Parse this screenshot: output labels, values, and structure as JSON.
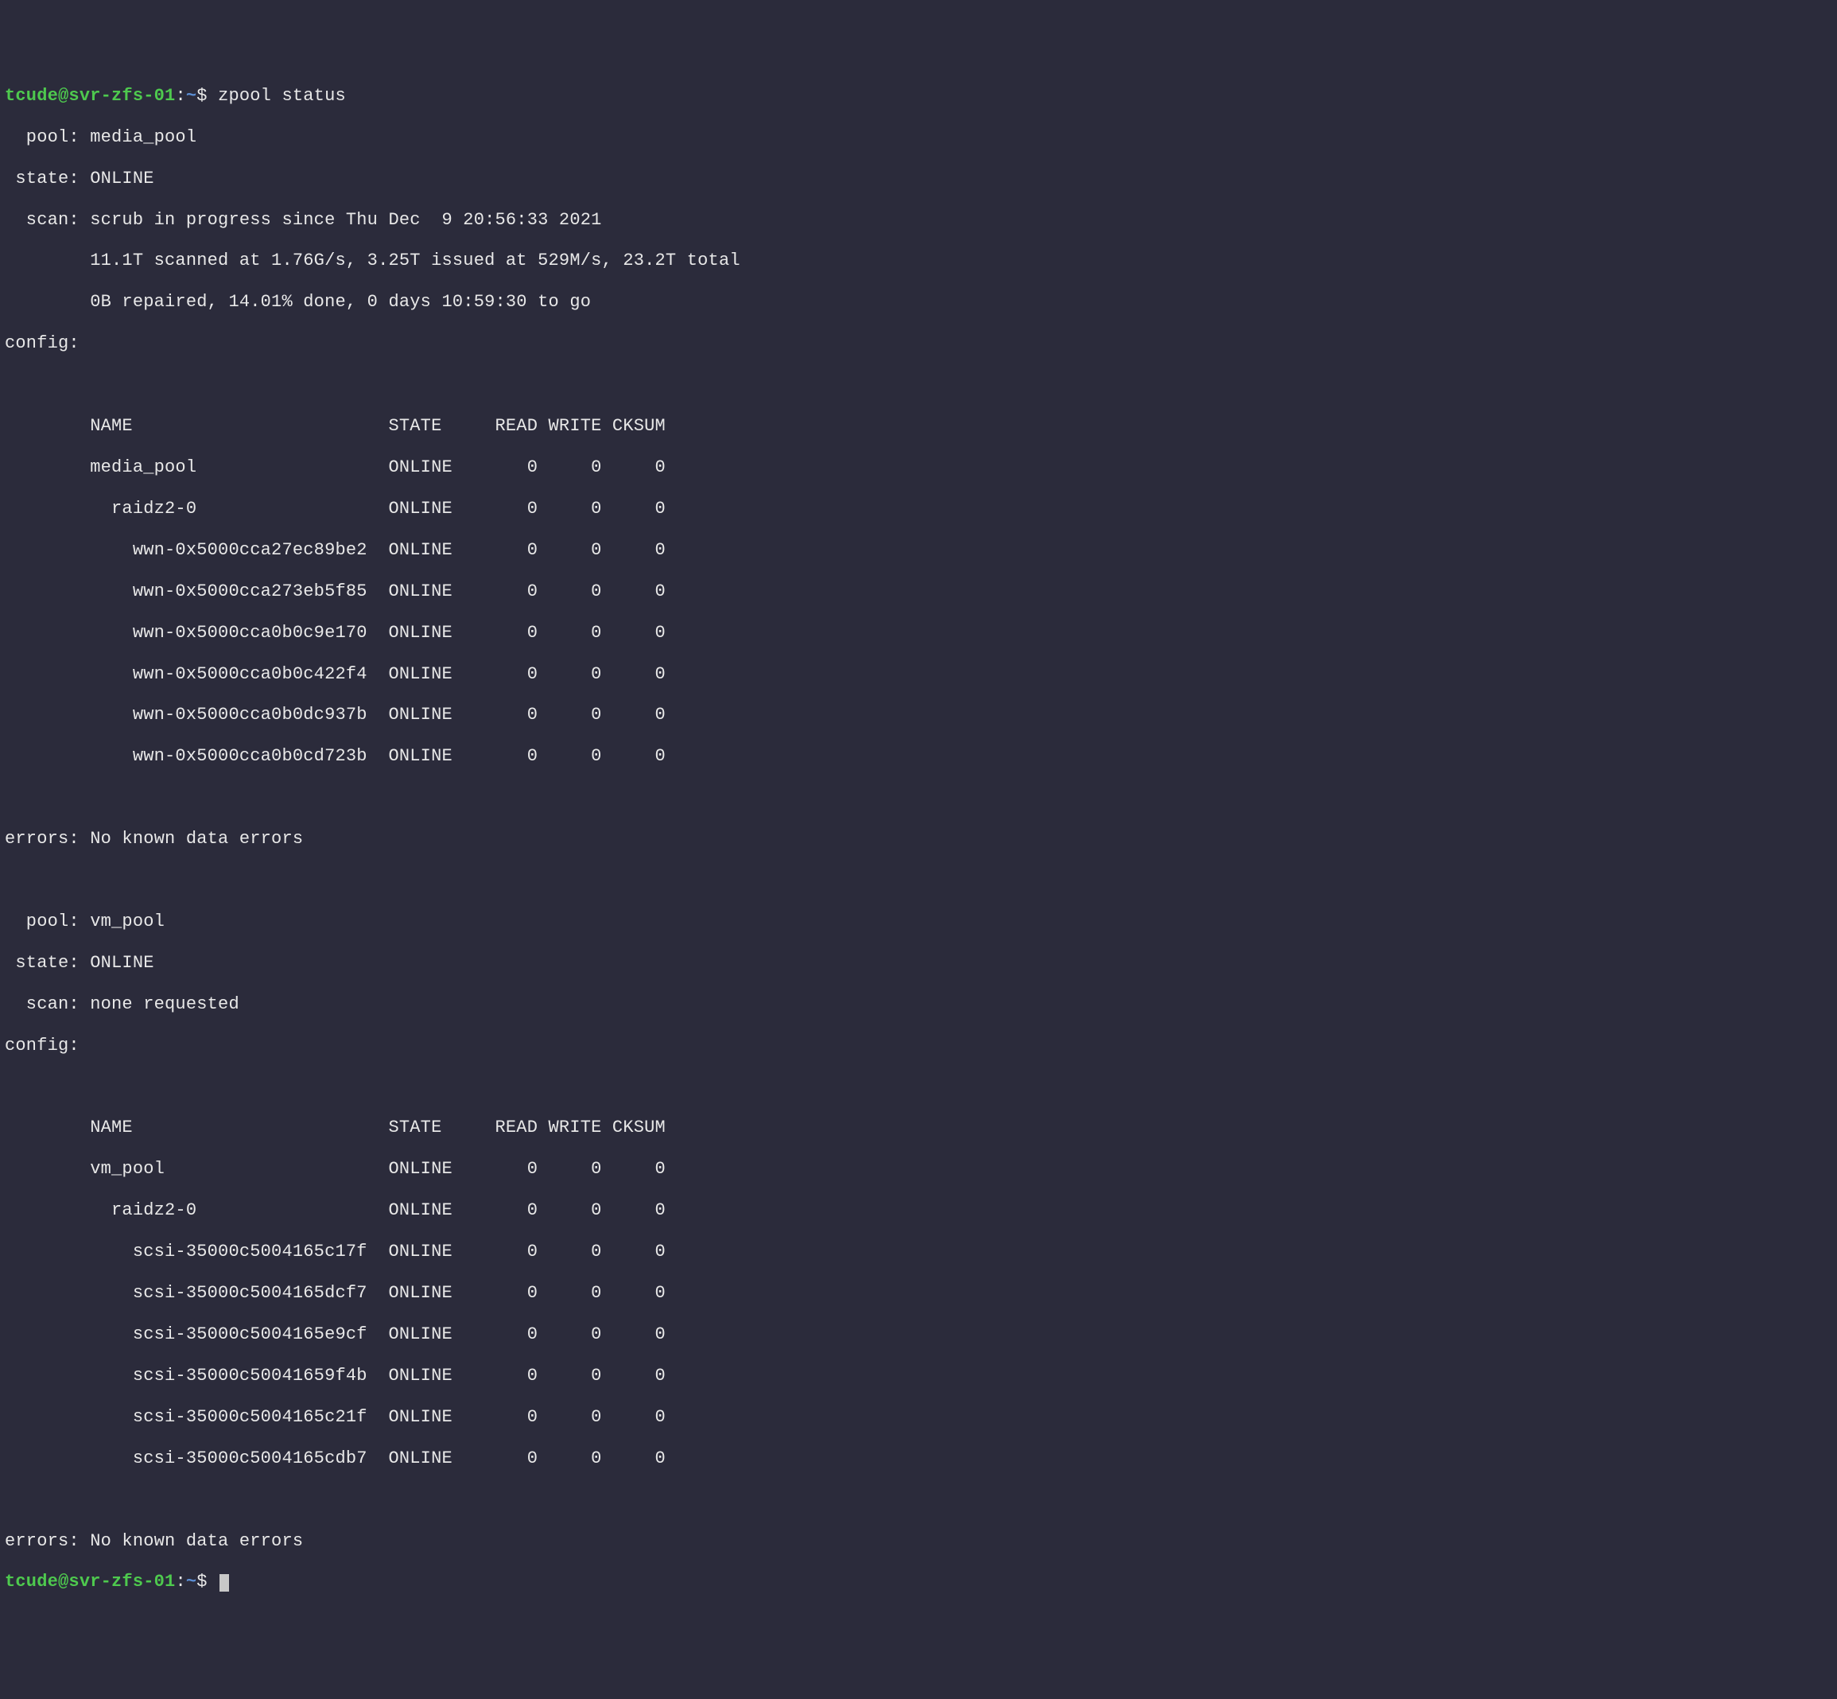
{
  "prompt1": {
    "user_host": "tcude@svr-zfs-01",
    "colon": ":",
    "path": "~",
    "dollar": "$ ",
    "command": "zpool status"
  },
  "pool1": {
    "pool_label": "  pool: ",
    "pool_name": "media_pool",
    "state_label": " state: ",
    "state_value": "ONLINE",
    "scan_label": "  scan: ",
    "scan_line1": "scrub in progress since Thu Dec  9 20:56:33 2021",
    "scan_line2": "        11.1T scanned at 1.76G/s, 3.25T issued at 529M/s, 23.2T total",
    "scan_line3": "        0B repaired, 14.01% done, 0 days 10:59:30 to go",
    "config_label": "config:",
    "header": "        NAME                        STATE     READ WRITE CKSUM",
    "rows": [
      "        media_pool                  ONLINE       0     0     0",
      "          raidz2-0                  ONLINE       0     0     0",
      "            wwn-0x5000cca27ec89be2  ONLINE       0     0     0",
      "            wwn-0x5000cca273eb5f85  ONLINE       0     0     0",
      "            wwn-0x5000cca0b0c9e170  ONLINE       0     0     0",
      "            wwn-0x5000cca0b0c422f4  ONLINE       0     0     0",
      "            wwn-0x5000cca0b0dc937b  ONLINE       0     0     0",
      "            wwn-0x5000cca0b0cd723b  ONLINE       0     0     0"
    ],
    "errors_label": "errors: ",
    "errors_value": "No known data errors"
  },
  "pool2": {
    "pool_label": "  pool: ",
    "pool_name": "vm_pool",
    "state_label": " state: ",
    "state_value": "ONLINE",
    "scan_label": "  scan: ",
    "scan_value": "none requested",
    "config_label": "config:",
    "header": "        NAME                        STATE     READ WRITE CKSUM",
    "rows": [
      "        vm_pool                     ONLINE       0     0     0",
      "          raidz2-0                  ONLINE       0     0     0",
      "            scsi-35000c5004165c17f  ONLINE       0     0     0",
      "            scsi-35000c5004165dcf7  ONLINE       0     0     0",
      "            scsi-35000c5004165e9cf  ONLINE       0     0     0",
      "            scsi-35000c50041659f4b  ONLINE       0     0     0",
      "            scsi-35000c5004165c21f  ONLINE       0     0     0",
      "            scsi-35000c5004165cdb7  ONLINE       0     0     0"
    ],
    "errors_label": "errors: ",
    "errors_value": "No known data errors"
  },
  "prompt2": {
    "user_host": "tcude@svr-zfs-01",
    "colon": ":",
    "path": "~",
    "dollar": "$ "
  }
}
